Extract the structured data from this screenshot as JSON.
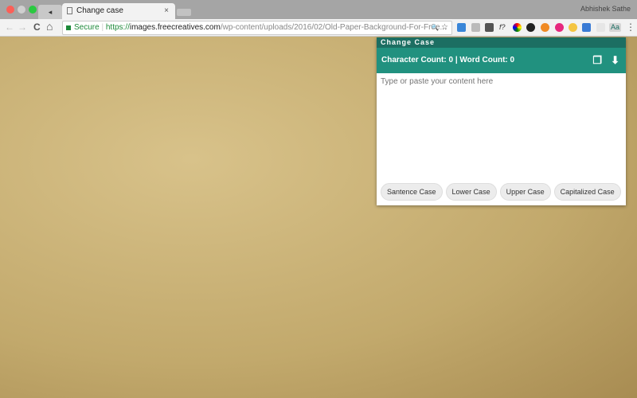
{
  "browser": {
    "tab_title": "Change case",
    "tab_close": "×",
    "pinned_tab": "◂",
    "user_name": "Abhishek Sathe",
    "url": {
      "secure": "Secure",
      "protocol": "https://",
      "host": "images.freecreatives.com",
      "path": "/wp-content/uploads/2016/02/Old-Paper-Background-For-Free..."
    },
    "nav": {
      "back": "←",
      "forward": "→",
      "reload": "C",
      "home": "⌂"
    },
    "zoom_icon": "🔍",
    "star": "☆",
    "menu": "⋮"
  },
  "extension": {
    "title": "Change Case",
    "character_count_label": "Character Count:",
    "character_count": "0",
    "separator": "|",
    "word_count_label": "Word Count:",
    "word_count": "0",
    "placeholder": "Type or paste your content here",
    "buttons": [
      "Santence Case",
      "Lower Case",
      "Upper Case",
      "Capitalized Case"
    ],
    "colors": {
      "header_dark": "#1c6e62",
      "header": "#21917f"
    }
  }
}
